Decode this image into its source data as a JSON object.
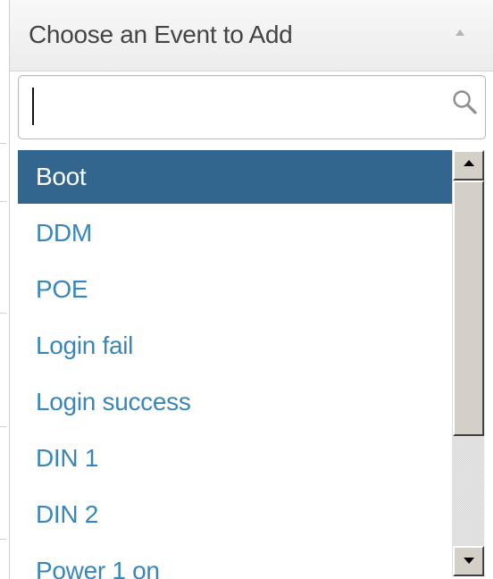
{
  "dropdown": {
    "title": "Choose an Event to Add",
    "caret_icon": "caret-up-icon",
    "search": {
      "value": "",
      "placeholder": "",
      "icon": "search-icon"
    },
    "items": [
      {
        "label": "Boot",
        "selected": true
      },
      {
        "label": "DDM",
        "selected": false
      },
      {
        "label": "POE",
        "selected": false
      },
      {
        "label": "Login fail",
        "selected": false
      },
      {
        "label": "Login success",
        "selected": false
      },
      {
        "label": "DIN 1",
        "selected": false
      },
      {
        "label": "DIN 2",
        "selected": false
      },
      {
        "label": "Power 1 on",
        "selected": false
      }
    ],
    "scrollbar": {
      "up_icon": "scroll-up-arrow-icon",
      "down_icon": "scroll-down-arrow-icon"
    }
  },
  "colors": {
    "selected_bg": "#33668e",
    "item_text": "#3a86b8",
    "header_text": "#444444"
  }
}
